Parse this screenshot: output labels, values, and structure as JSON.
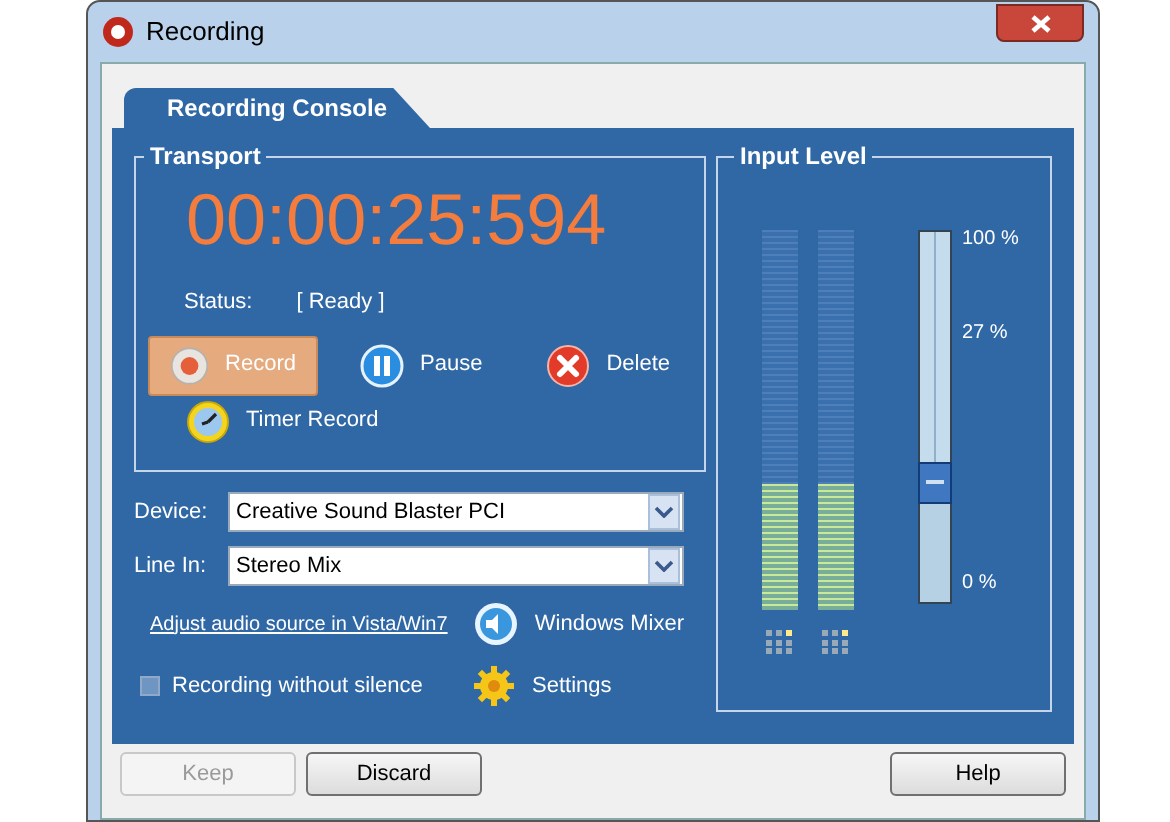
{
  "window": {
    "title": "Recording"
  },
  "tabs": [
    {
      "label": "Recording Console",
      "selected": true
    }
  ],
  "transport": {
    "title": "Transport",
    "time": "00:00:25:594",
    "status_label": "Status:",
    "status_value": "[ Ready ]",
    "buttons": [
      {
        "kind": "record",
        "label": "Record",
        "selected": true
      },
      {
        "kind": "pause",
        "label": "Pause",
        "selected": false
      },
      {
        "kind": "delete",
        "label": "Delete",
        "selected": false
      },
      {
        "kind": "timer",
        "label": "Timer Record",
        "selected": false
      }
    ]
  },
  "device": {
    "label": "Device:",
    "value": "Creative Sound Blaster PCI"
  },
  "line_in": {
    "label": "Line In:",
    "value": "Stereo Mix"
  },
  "link": "Adjust audio source in Vista/Win7",
  "mixer": {
    "label": "Windows Mixer"
  },
  "silence": {
    "label": "Recording without silence",
    "checked": false
  },
  "settings": {
    "label": "Settings"
  },
  "input_level": {
    "title": "Input Level",
    "meters": [
      {
        "level": 0.33
      },
      {
        "level": 0.33
      }
    ],
    "slider": {
      "level": 0.32
    },
    "scale": [
      "100 %",
      "27 %",
      "0 %"
    ]
  },
  "footer_buttons": [
    {
      "label": "Keep",
      "disabled": true
    },
    {
      "label": "Discard",
      "disabled": false
    },
    {
      "label": "Help",
      "disabled": false
    }
  ]
}
